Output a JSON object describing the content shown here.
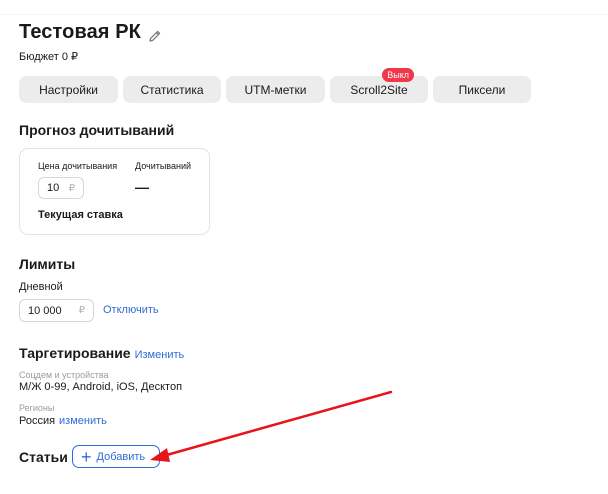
{
  "campaign": {
    "title": "Тестовая РК",
    "edit_icon": "pencil-icon",
    "budget": "Бюджет 0 ₽"
  },
  "tabs": [
    {
      "label": "Настройки"
    },
    {
      "label": "Статистика"
    },
    {
      "label": "UTM-метки"
    },
    {
      "label": "Scroll2Site",
      "badge": "Выкл"
    },
    {
      "label": "Пиксели"
    }
  ],
  "forecast": {
    "heading": "Прогноз дочитываний",
    "price_label": "Цена дочитывания",
    "reads_label": "Дочитываний",
    "price_value": "10",
    "currency": "₽",
    "reads_value": "—",
    "current_rate": "Текущая ставка"
  },
  "limits": {
    "heading": "Лимиты",
    "daily_label": "Дневной",
    "daily_value": "10 000",
    "currency": "₽",
    "disable_link": "Отключить"
  },
  "targeting": {
    "heading": "Таргетирование",
    "edit_link": "Изменить",
    "demo_label": "Соцдем и устройства",
    "demo_value": "М/Ж 0-99, Android, iOS, Десктоп",
    "regions_label": "Регионы",
    "regions_value": "Россия",
    "regions_link": "изменить"
  },
  "articles": {
    "heading": "Статьи",
    "add_label": "Добавить",
    "add_icon": "plus-icon"
  },
  "colors": {
    "link": "#2f6bd8",
    "badge": "#f0384a",
    "arrow": "#e8141c",
    "tab_bg": "#ececec"
  }
}
